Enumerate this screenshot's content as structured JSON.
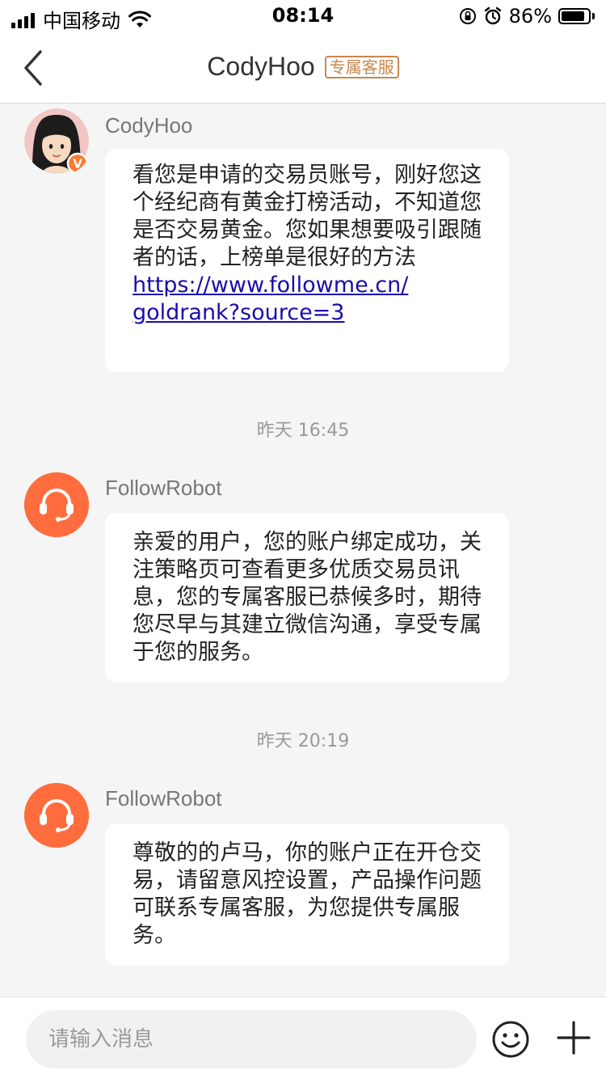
{
  "status_bar": {
    "carrier": "中国移动",
    "time": "08:14",
    "battery_percent": "86%",
    "battery_level": 0.86,
    "icons": [
      "signal-icon",
      "wifi-icon",
      "orientation-lock-icon",
      "alarm-icon",
      "battery-icon"
    ]
  },
  "nav": {
    "title": "CodyHoo",
    "badge": "专属客服",
    "back_icon": "chevron-left-icon"
  },
  "messages": [
    {
      "sender": "CodyHoo",
      "avatar": "user-avatar-with-verified-badge",
      "verified_mark": "V",
      "text": "看您是申请的交易员账号，刚好您这个经纪商有黄金打榜活动，不知道您是否交易黄金。您如果想要吸引跟随者的话，上榜单是很好的方法",
      "link_line1": "https://www.followme.cn/",
      "link_line2": "goldrank?source=3"
    },
    {
      "timestamp": "昨天 16:45"
    },
    {
      "sender": "FollowRobot",
      "avatar": "headset-icon",
      "text": "亲爱的用户，您的账户绑定成功，关注策略页可查看更多优质交易员讯息，您的专属客服已恭候多时，期待您尽早与其建立微信沟通，享受专属于您的服务。"
    },
    {
      "timestamp": "昨天 20:19"
    },
    {
      "sender": "FollowRobot",
      "avatar": "headset-icon",
      "text": "尊敬的的卢马，你的账户正在开仓交易，请留意风控设置，产品操作问题可联系专属客服，为您提供专属服务。"
    }
  ],
  "input_bar": {
    "placeholder": "请输入消息",
    "emoji_icon": "smiley-icon",
    "plus_icon": "plus-icon"
  },
  "colors": {
    "robot_avatar": "#ff6d3f",
    "badge": "#c8874f",
    "link": "#1a0dab",
    "background": "#f5f5f5"
  }
}
